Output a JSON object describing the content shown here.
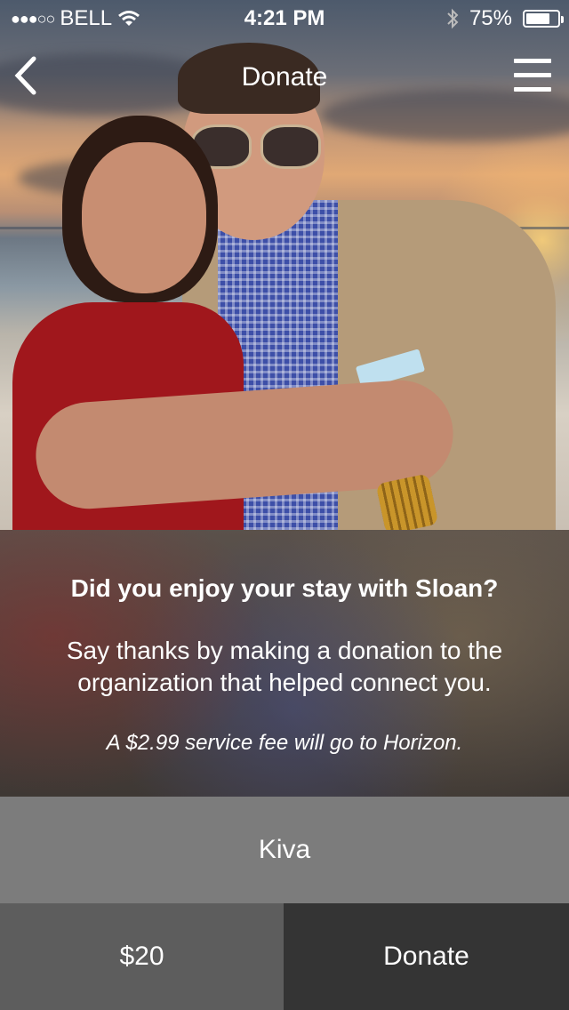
{
  "status_bar": {
    "carrier": "BELL",
    "signal_dots": "●●●○○",
    "time": "4:21 PM",
    "battery_percent": "75%",
    "battery_level": 0.75
  },
  "nav": {
    "title": "Donate",
    "back_icon": "chevron-left-icon",
    "menu_icon": "hamburger-menu-icon"
  },
  "info": {
    "question": "Did you enjoy your stay with Sloan?",
    "message": "Say thanks by making a donation to the organization that helped connect you.",
    "fee_note": "A $2.99 service fee will go to Horizon."
  },
  "organization": "Kiva",
  "amount": "$20",
  "donate_label": "Donate",
  "colors": {
    "org_row": "#7c7c7c",
    "amount_cell": "#5d5d5d",
    "donate_cell": "#343434"
  }
}
